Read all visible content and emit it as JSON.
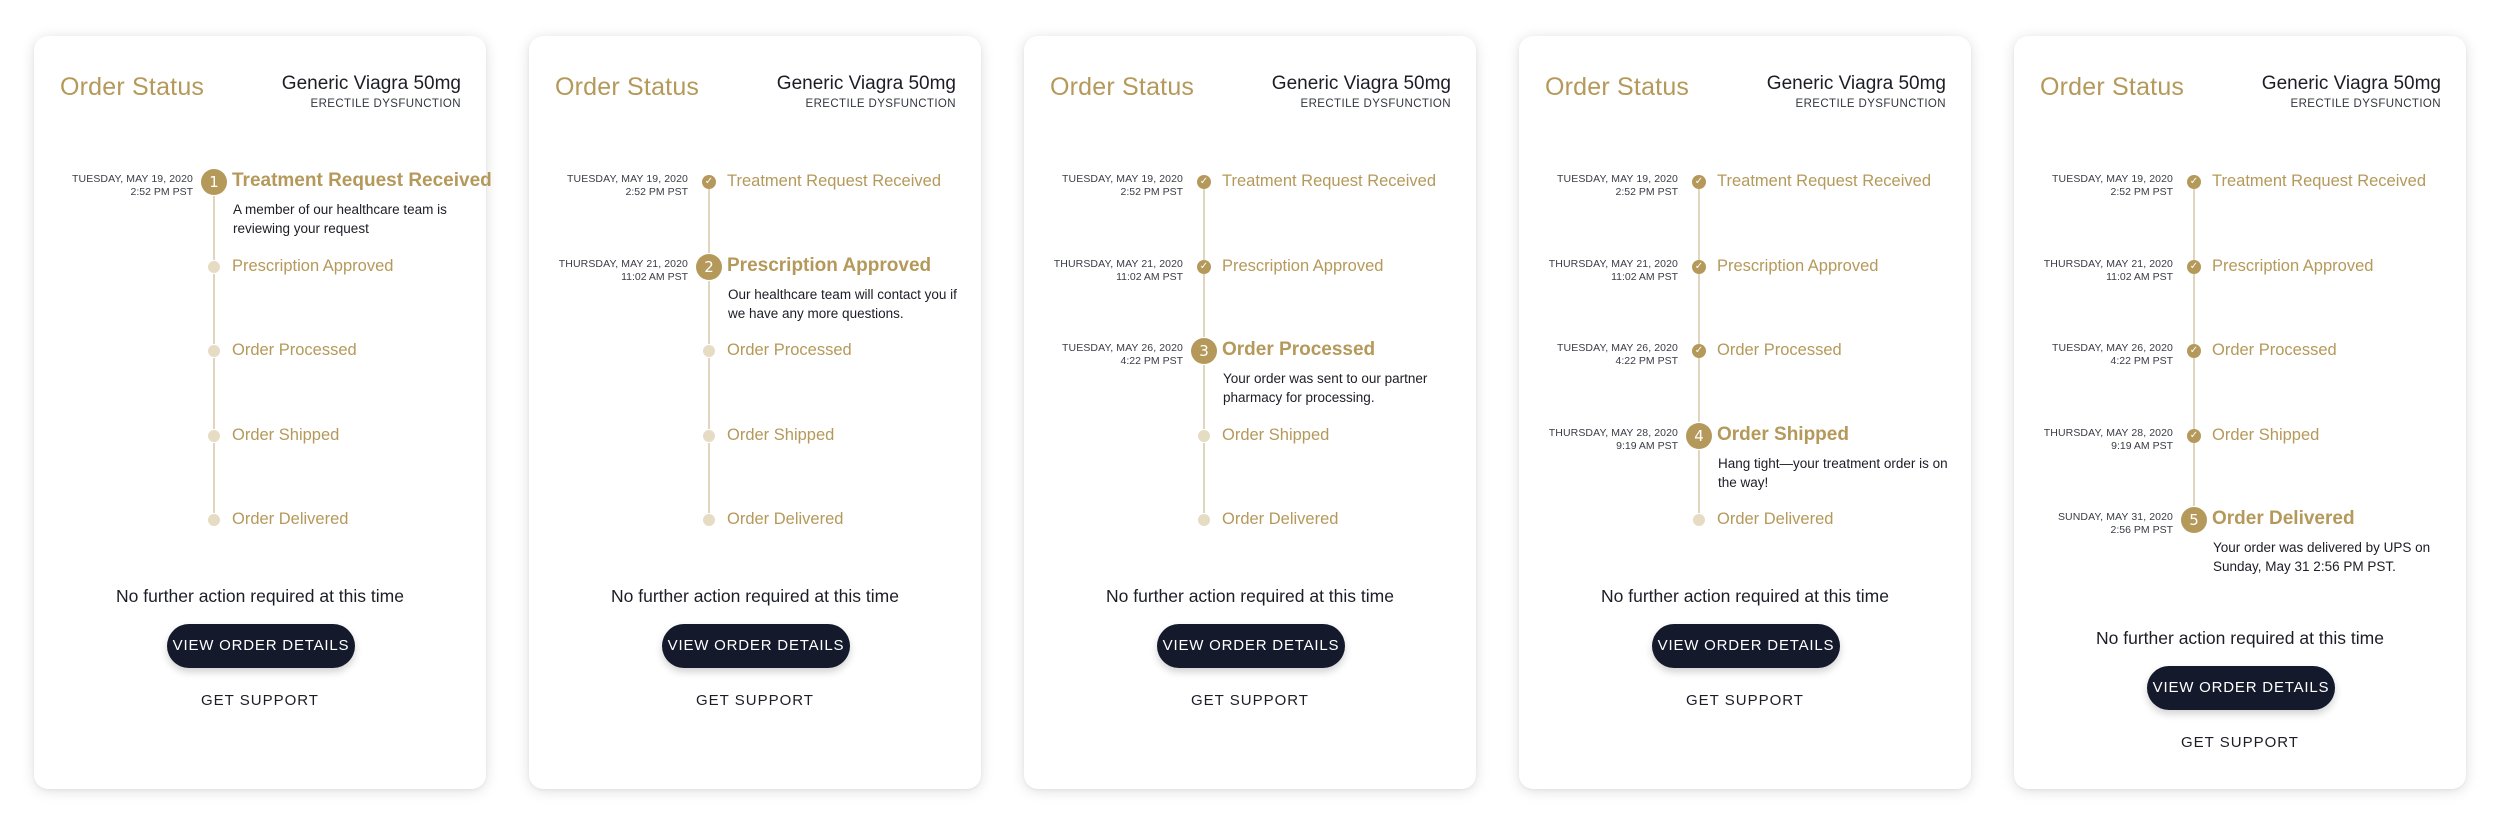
{
  "title": "Order Status",
  "product": {
    "name": "Generic Viagra 50mg",
    "category": "ERECTILE DYSFUNCTION"
  },
  "steps": [
    {
      "label": "Treatment Request Received",
      "date": "TUESDAY, MAY 19, 2020",
      "time": "2:52 PM PST",
      "description": "A member of our healthcare team is reviewing your request"
    },
    {
      "label": "Prescription Approved",
      "date": "THURSDAY, MAY 21, 2020",
      "time": "11:02 AM PST",
      "description": "Our healthcare team will contact you if we have any more questions."
    },
    {
      "label": "Order Processed",
      "date": "TUESDAY, MAY 26, 2020",
      "time": "4:22 PM PST",
      "description": "Your order was sent to our partner pharmacy for processing."
    },
    {
      "label": "Order Shipped",
      "date": "THURSDAY, MAY 28, 2020",
      "time": "9:19 AM PST",
      "description": "Hang tight—your treatment order is on the way!"
    },
    {
      "label": "Order Delivered",
      "date": "SUNDAY, MAY 31, 2020",
      "time": "2:56 PM PST",
      "description": "Your order was delivered by UPS on Sunday, May 31 2:56 PM PST."
    }
  ],
  "cards": [
    {
      "current_step": 1
    },
    {
      "current_step": 2
    },
    {
      "current_step": 3
    },
    {
      "current_step": 4
    },
    {
      "current_step": 5
    }
  ],
  "no_action_text": "No further action required at this time",
  "view_button_label": "VIEW ORDER DETAILS",
  "support_label": "GET SUPPORT",
  "icons": {
    "completed": "check-icon"
  },
  "colors": {
    "gold": "#b5995a",
    "gold_light": "#e6dcc4",
    "navy": "#14192b",
    "text": "#1c1d26"
  }
}
